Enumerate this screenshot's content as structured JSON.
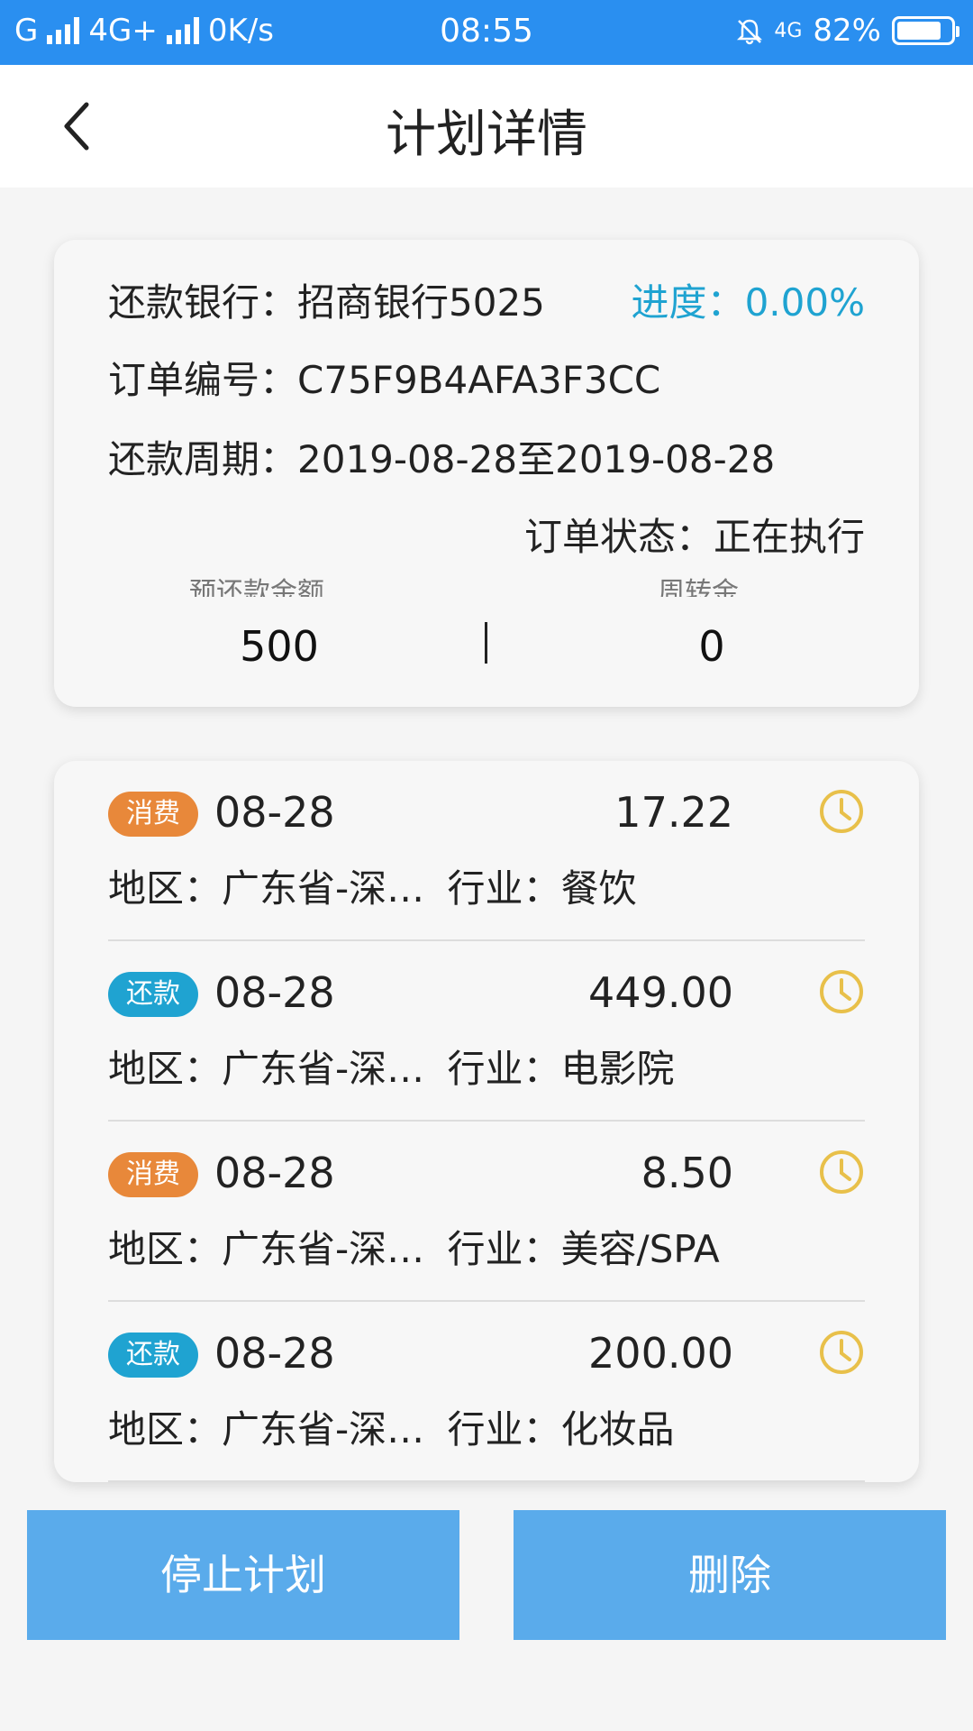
{
  "status_bar": {
    "carrier": "G",
    "network": "4G+",
    "speed": "0K/s",
    "time": "08:55",
    "net2": "4G",
    "battery_percent": "82%",
    "battery_level": 0.82
  },
  "nav": {
    "title": "计划详情"
  },
  "summary": {
    "bank_label": "还款银行：",
    "bank_value": "招商银行5025",
    "progress_label": "进度：",
    "progress_value": "0.00%",
    "order_label": "订单编号：",
    "order_value": "C75F9B4AFA3F3CC",
    "period_label": "还款周期：",
    "period_value": "2019-08-28至2019-08-28",
    "status_label": "订单状态：",
    "status_value": "正在执行",
    "total_label": "预还款金额",
    "total_value": "500",
    "turnover_label": "周转金",
    "turnover_value": "0"
  },
  "items": [
    {
      "type": "消费",
      "color": "#e8883a",
      "date": "08-28",
      "amount": "17.22",
      "region_label": "地区：",
      "region": "广东省-深…",
      "industry_label": "行业：",
      "industry": "餐饮"
    },
    {
      "type": "还款",
      "color": "#1fa3d1",
      "date": "08-28",
      "amount": "449.00",
      "region_label": "地区：",
      "region": "广东省-深…",
      "industry_label": "行业：",
      "industry": "电影院"
    },
    {
      "type": "消费",
      "color": "#e8883a",
      "date": "08-28",
      "amount": "8.50",
      "region_label": "地区：",
      "region": "广东省-深…",
      "industry_label": "行业：",
      "industry": "美容/SPA"
    },
    {
      "type": "还款",
      "color": "#1fa3d1",
      "date": "08-28",
      "amount": "200.00",
      "region_label": "地区：",
      "region": "广东省-深…",
      "industry_label": "行业：",
      "industry": "化妆品"
    }
  ],
  "buttons": {
    "stop": "停止计划",
    "delete": "删除"
  },
  "colors": {
    "status_bar": "#2a8ff0",
    "accent": "#1fa3d1",
    "consume_badge": "#e8883a",
    "clock_icon": "#e8c04a",
    "button": "#5aabeb"
  }
}
